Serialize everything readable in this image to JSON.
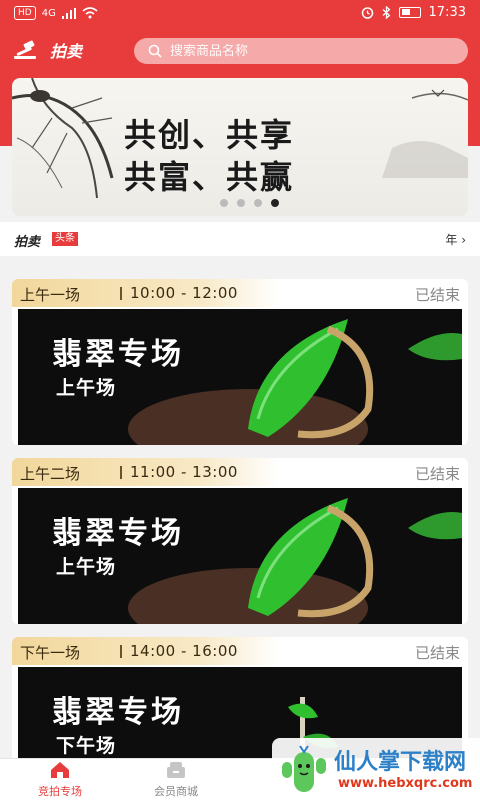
{
  "status_bar": {
    "hd": "HD",
    "network": "4G",
    "time": "17:33"
  },
  "header": {
    "logo_text": "拍卖",
    "search_placeholder": "搜索商品名称"
  },
  "banner": {
    "line1": "共创、共享",
    "line2": "共富、共赢",
    "dot_count": 4,
    "active_dot": 3
  },
  "news": {
    "title": "拍卖",
    "tag": "头条",
    "more_label": "年"
  },
  "sessions": [
    {
      "name": "上午一场",
      "time": "10:00 - 12:00",
      "status": "已结束",
      "image_title": "翡翠专场",
      "image_subtitle": "上午场"
    },
    {
      "name": "上午二场",
      "time": "11:00 - 13:00",
      "status": "已结束",
      "image_title": "翡翠专场",
      "image_subtitle": "上午场"
    },
    {
      "name": "下午一场",
      "time": "14:00 - 16:00",
      "status": "已结束",
      "image_title": "翡翠专场",
      "image_subtitle": "下午场"
    }
  ],
  "bottom_nav": [
    {
      "label": "竞拍专场",
      "icon": "home-icon",
      "active": true
    },
    {
      "label": "会员商城",
      "icon": "store-icon",
      "active": false
    }
  ],
  "watermark": {
    "text": "仙人掌下载网",
    "url": "www.hebxqrc.com"
  },
  "colors": {
    "accent": "#e83b3b",
    "gold": "#f2d79b",
    "jade": "#2fbf2f"
  }
}
